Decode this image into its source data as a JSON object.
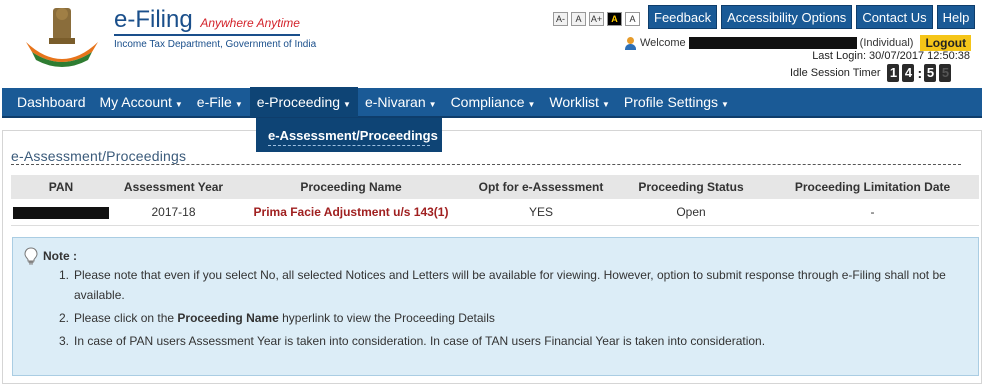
{
  "header": {
    "brand_title": "e-Filing",
    "brand_tagline": "Anywhere Anytime",
    "brand_sub": "Income Tax Department, Government of India",
    "font_sizes": [
      "A-",
      "A",
      "A+",
      "A",
      "A"
    ],
    "buttons": [
      "Feedback",
      "Accessibility Options",
      "Contact Us",
      "Help"
    ],
    "welcome_label": "Welcome",
    "user_type": "(Individual)",
    "logout_label": "Logout",
    "last_login": "Last Login: 30/07/2017 12:50:38",
    "idle_label": "Idle Session Timer",
    "timer": [
      "1",
      "4",
      "5",
      "5"
    ]
  },
  "nav": {
    "items": [
      "Dashboard",
      "My Account",
      "e-File",
      "e-Proceeding",
      "e-Nivaran",
      "Compliance",
      "Worklist",
      "Profile Settings"
    ],
    "active": "e-Proceeding",
    "dropdown_item": "e-Assessment/Proceedings"
  },
  "main": {
    "title": "e-Assessment/Proceedings",
    "table": {
      "headers": [
        "PAN",
        "Assessment Year",
        "Proceeding Name",
        "Opt for e-Assessment",
        "Proceeding Status",
        "Proceeding Limitation Date"
      ],
      "rows": [
        [
          "",
          "2017-18",
          "Prima Facie Adjustment u/s 143(1)",
          "YES",
          "Open",
          "-"
        ]
      ]
    },
    "note": {
      "title": "Note :",
      "items": [
        {
          "num": "1.",
          "text": "Please note that even if you select No, all selected Notices and Letters will be available for viewing. However, option to submit response through e-Filing shall not be available."
        },
        {
          "num": "2.",
          "pre": "Please click on the ",
          "bold": "Proceeding Name",
          "post": " hyperlink to view the Proceeding Details"
        },
        {
          "num": "3.",
          "text": "In case of PAN users Assessment Year is taken into consideration. In case of TAN users Financial Year is taken into consideration."
        }
      ]
    }
  },
  "colors": {
    "nav_blue": "#1a5a96",
    "nav_active": "#0e4475",
    "link_red": "#a02020",
    "note_bg": "#dcedf7",
    "logout_yellow": "#f5c518"
  }
}
